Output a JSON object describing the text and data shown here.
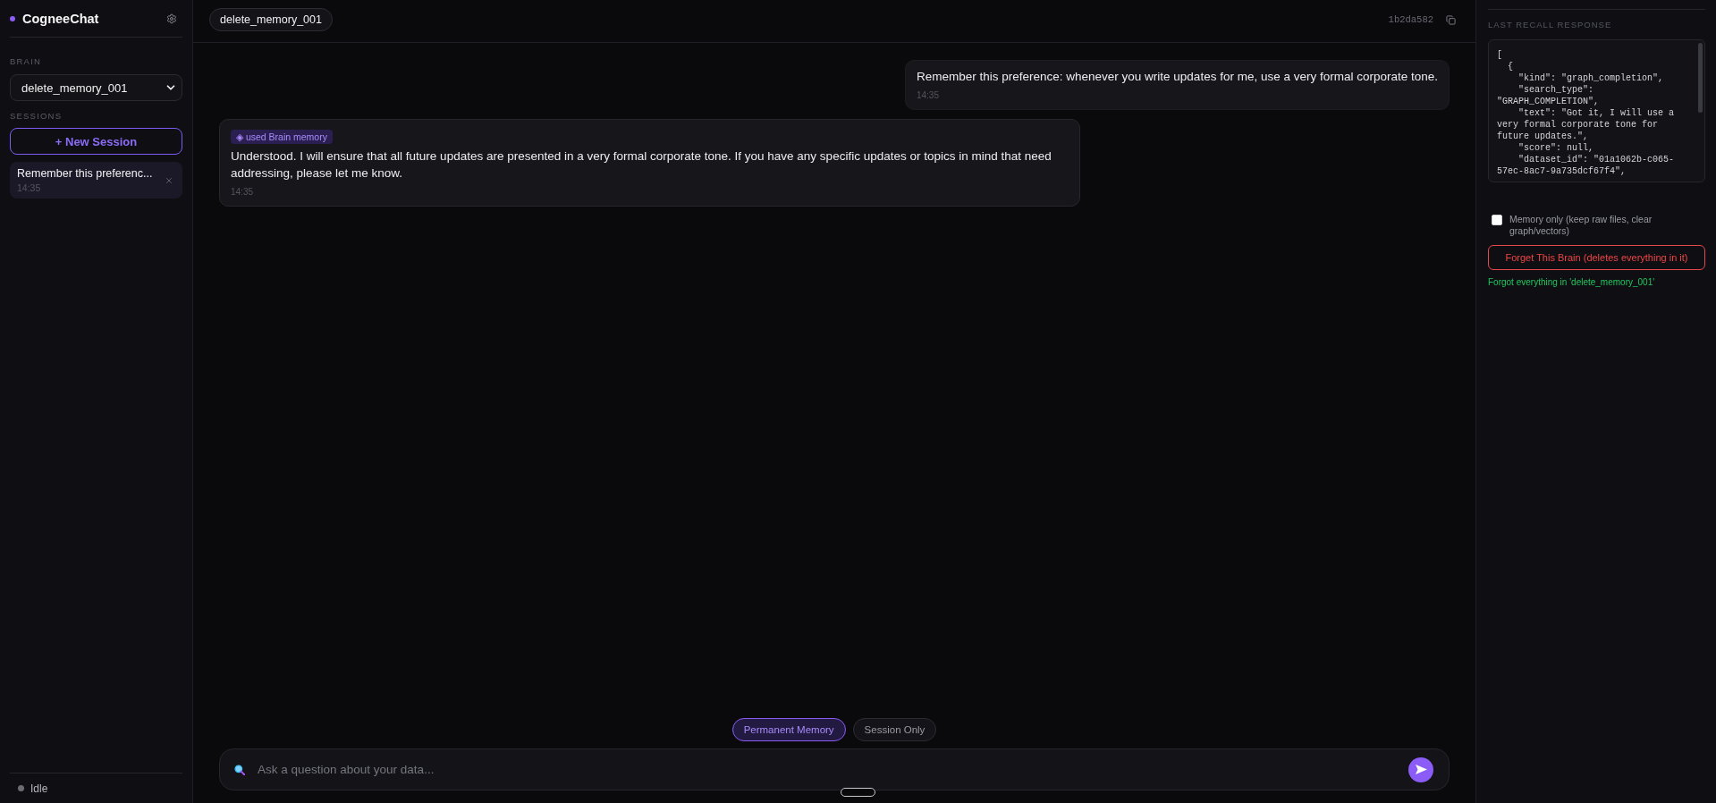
{
  "sidebar": {
    "app_title": "CogneeChat",
    "brain_label": "BRAIN",
    "brain_select": {
      "value": "delete_memory_001"
    },
    "sessions_label": "SESSIONS",
    "new_session_button": "+ New Session",
    "sessions": [
      {
        "title": "Remember this preferenc...",
        "time": "14:35",
        "selected": true
      }
    ],
    "status": {
      "label": "Idle"
    }
  },
  "header": {
    "brain_chip": "delete_memory_001",
    "session_id": "1b2da582"
  },
  "messages": [
    {
      "kind": "user",
      "text": "Remember this preference: whenever you write updates for me, use a very formal corporate tone.",
      "time": "14:35"
    },
    {
      "kind": "assistant",
      "badge": "◈ used Brain memory",
      "text": "Understood. I will ensure that all future updates are presented in a very formal corporate tone. If you have any specific updates or topics in mind that need addressing, please let me know.",
      "time": "14:35"
    }
  ],
  "memory_modes": [
    {
      "label": "Permanent Memory",
      "selected": true
    },
    {
      "label": "Session Only",
      "selected": false
    }
  ],
  "composer": {
    "placeholder": "Ask a question about your data..."
  },
  "recall_panel": {
    "title": "LAST RECALL RESPONSE",
    "response_lines": [
      "[",
      "  {",
      "    \"kind\": \"graph_completion\",",
      "    \"search_type\":",
      "\"GRAPH_COMPLETION\",",
      "    \"text\": \"Got it, I will use a",
      "very formal corporate tone for",
      "future updates.\",",
      "    \"score\": null,",
      "    \"dataset_id\": \"01a1062b-c065-",
      "57ec-8ac7-9a735dcf67f4\","
    ],
    "memory_only": {
      "label": "Memory only (keep raw files, clear graph/vectors)",
      "checked": false
    },
    "forget_button": "Forget This Brain (deletes everything in it)",
    "status_message": "Forgot everything in 'delete_memory_001'"
  }
}
